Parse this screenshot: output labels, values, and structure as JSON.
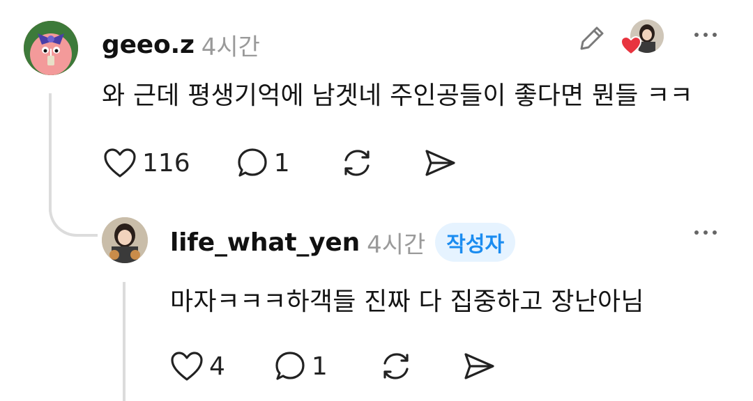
{
  "comment": {
    "username": "geeo.z",
    "time": "4시간",
    "text": "와 근데 평생기억에 남겟네 주인공들이 좋다면 뭔들 ㅋㅋ",
    "likes": "116",
    "replies": "1",
    "icons": [
      "heart-icon",
      "comment-icon",
      "repost-icon",
      "share-icon",
      "edit-icon",
      "more-icon"
    ]
  },
  "reply": {
    "username": "life_what_yen",
    "time": "4시간",
    "badge": "작성자",
    "text": "마자ㅋㅋㅋ하객들 진짜 다 집중하고 장난아님",
    "likes": "4",
    "replies": "1",
    "icons": [
      "heart-icon",
      "comment-icon",
      "repost-icon",
      "share-icon",
      "more-icon"
    ]
  },
  "colors": {
    "badge_bg": "#e6f3ff",
    "badge_text": "#1b8cf0",
    "liked_heart": "#e8343f",
    "time_gray": "#9a9a9a"
  }
}
